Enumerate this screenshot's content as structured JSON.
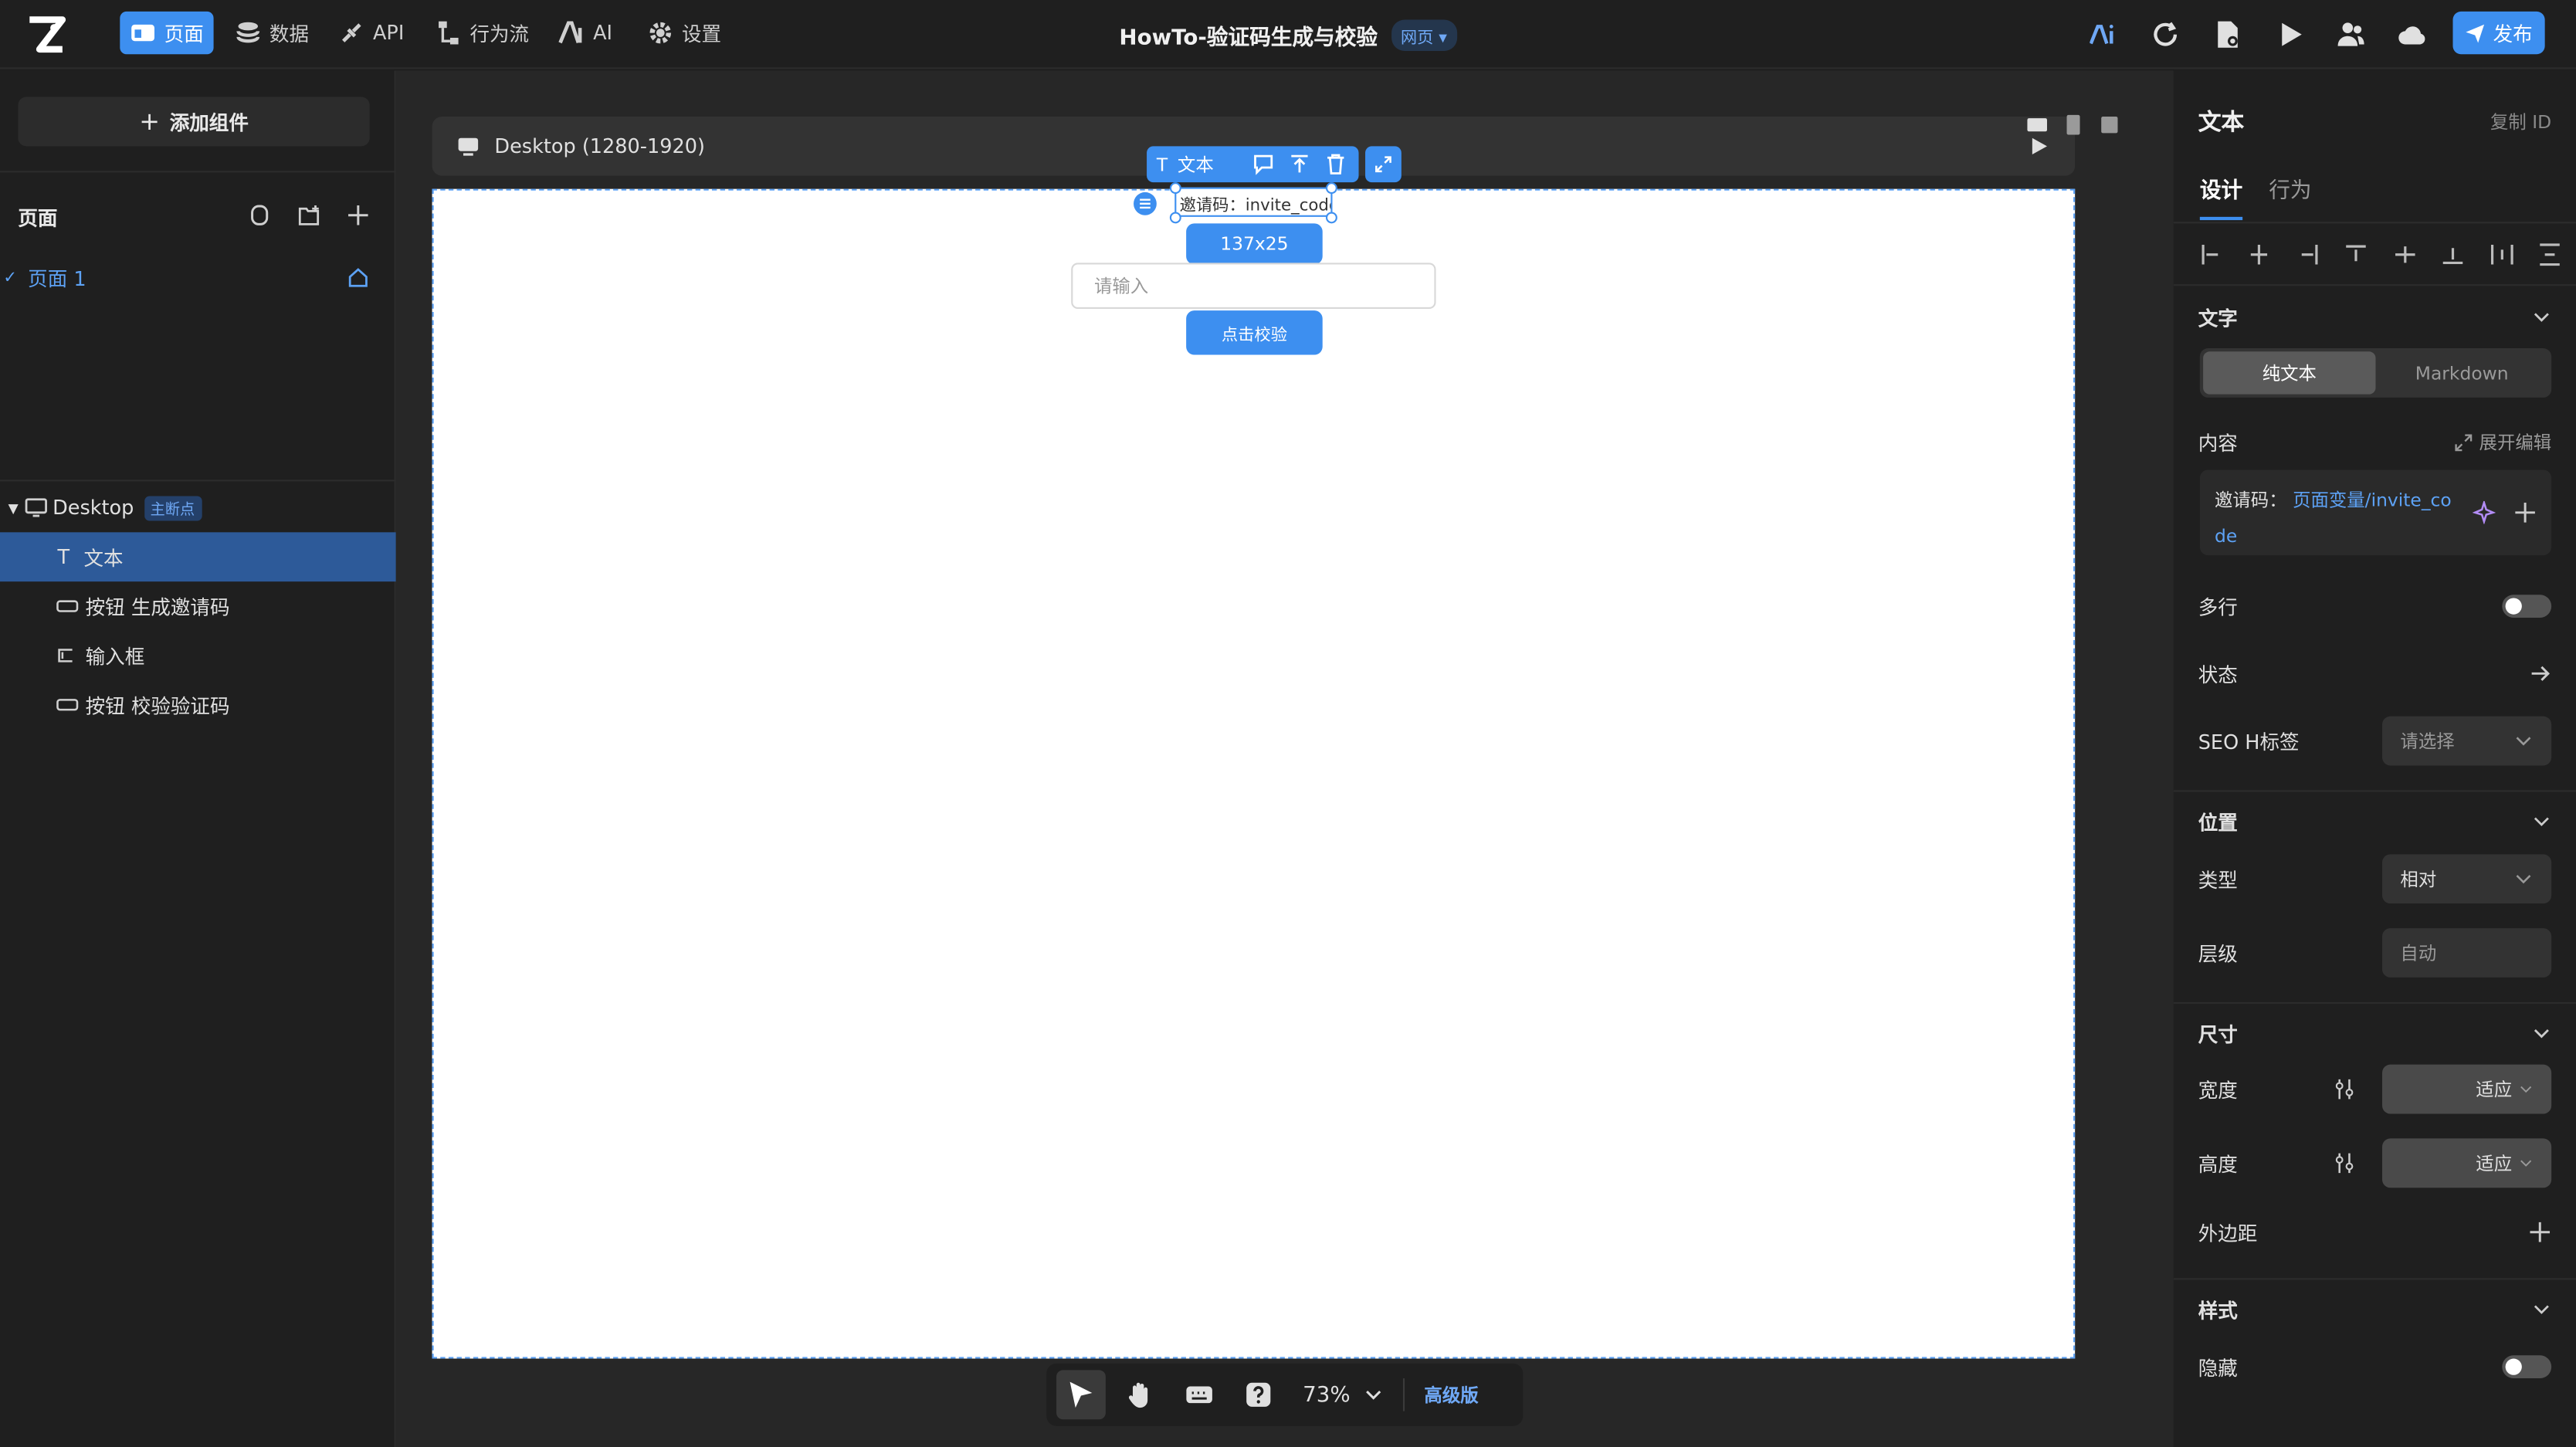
{
  "topbar": {
    "nav": [
      {
        "label": "页面",
        "icon": "page-icon"
      },
      {
        "label": "数据",
        "icon": "database-icon"
      },
      {
        "label": "API",
        "icon": "api-icon"
      },
      {
        "label": "行为流",
        "icon": "flow-icon"
      },
      {
        "label": "AI",
        "icon": "ai-icon"
      },
      {
        "label": "设置",
        "icon": "gear-icon"
      }
    ],
    "project_title": "HowTo-验证码生成与校验",
    "project_type": "网页",
    "publish_label": "发布"
  },
  "left": {
    "add_component": "添加组件",
    "pages_title": "页面",
    "page_name": "页面 1",
    "tree_root": "Desktop",
    "tree_root_tag": "主断点",
    "tree_items": [
      {
        "icon": "text-icon",
        "label": "文本"
      },
      {
        "icon": "button-icon",
        "label": "按钮 生成邀请码"
      },
      {
        "icon": "input-icon",
        "label": "输入框"
      },
      {
        "icon": "button-icon",
        "label": "按钮 校验验证码"
      }
    ]
  },
  "canvas": {
    "device_label": "Desktop (1280-1920)",
    "float_toolbar_label": "文本",
    "selected_text": "邀请码：invite_code",
    "size_badge": "137x25",
    "input_placeholder": "请输入",
    "verify_button": "点击校验",
    "zoom": "73%",
    "edition": "高级版"
  },
  "right": {
    "title": "文本",
    "copy_id": "复制 ID",
    "tabs": [
      "设计",
      "行为"
    ],
    "text_section": "文字",
    "mode_plain": "纯文本",
    "mode_markdown": "Markdown",
    "content_label": "内容",
    "expand_edit": "展开编辑",
    "content_prefix": "邀请码：",
    "content_var": "页面变量/invite_co",
    "content_var_2": "de",
    "multiline": "多行",
    "state": "状态",
    "seo_label": "SEO H标签",
    "seo_placeholder": "请选择",
    "position_section": "位置",
    "type_label": "类型",
    "type_value": "相对",
    "layer_label": "层级",
    "layer_value": "自动",
    "size_section": "尺寸",
    "width_label": "宽度",
    "width_value": "适应",
    "height_label": "高度",
    "height_value": "适应",
    "margin_label": "外边距",
    "style_section": "样式",
    "hidden_label": "隐藏"
  },
  "colors": {
    "accent": "#3d8ff0",
    "bg": "#1f1f1f",
    "canvas_bg": "#272727"
  }
}
